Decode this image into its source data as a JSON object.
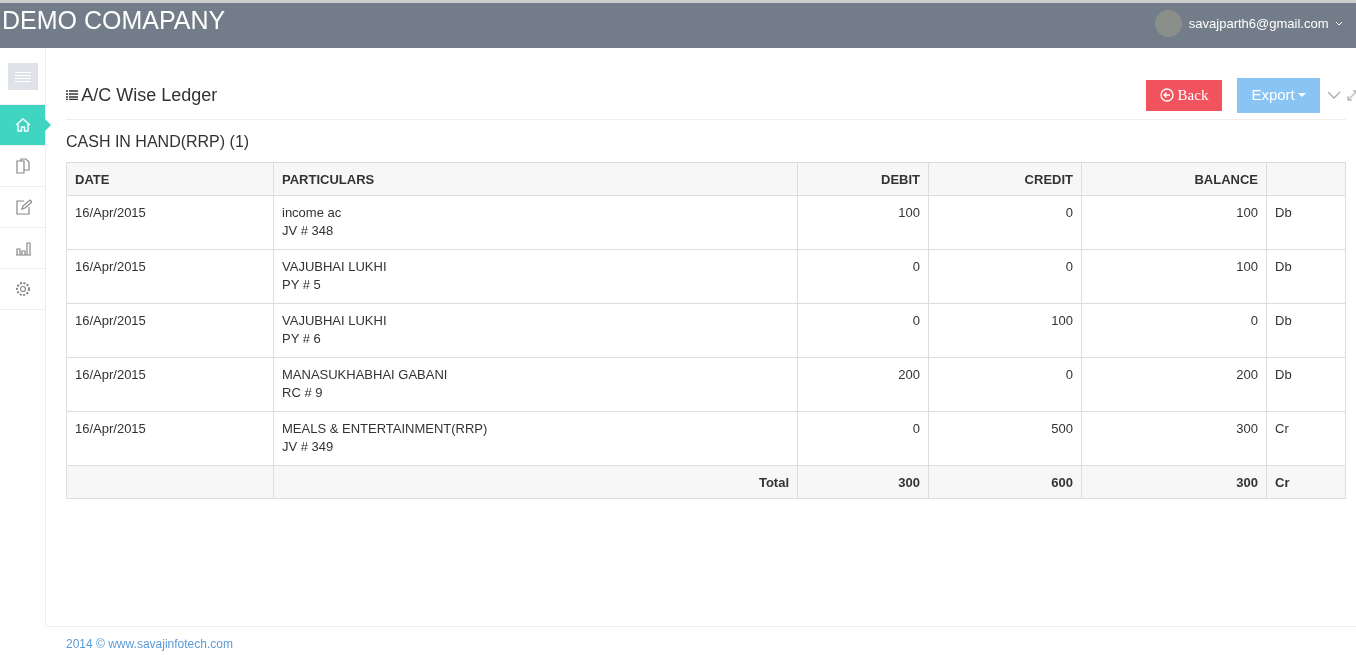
{
  "header": {
    "brand": "DEMO COMAPANY",
    "user_email": "savajparth6@gmail.com"
  },
  "sidebar": {
    "items": [
      {
        "kind": "home",
        "selected": true
      },
      {
        "kind": "documents",
        "selected": false
      },
      {
        "kind": "edit",
        "selected": false
      },
      {
        "kind": "chart",
        "selected": false
      },
      {
        "kind": "settings",
        "selected": false
      }
    ]
  },
  "panel": {
    "title": "A/C Wise Ledger",
    "buttons": [
      {
        "kind": "back",
        "label": "Back"
      },
      {
        "kind": "export",
        "label": "Export"
      }
    ]
  },
  "ledger": {
    "account": "CASH IN HAND(RRP) (1)",
    "columns": [
      "DATE",
      "PARTICULARS",
      "DEBIT",
      "CREDIT",
      "BALANCE"
    ],
    "rows": [
      {
        "date": "16/Apr/2015",
        "particulars": "income ac",
        "voucher": "JV # 348",
        "debit": "100",
        "credit": "0",
        "balance": "100",
        "type": "Db"
      },
      {
        "date": "16/Apr/2015",
        "particulars": "VAJUBHAI LUKHI",
        "voucher": "PY # 5",
        "debit": "0",
        "credit": "0",
        "balance": "100",
        "type": "Db"
      },
      {
        "date": "16/Apr/2015",
        "particulars": "VAJUBHAI LUKHI",
        "voucher": "PY # 6",
        "debit": "0",
        "credit": "100",
        "balance": "0",
        "type": "Db"
      },
      {
        "date": "16/Apr/2015",
        "particulars": "MANASUKHABHAI GABANI",
        "voucher": "RC # 9",
        "debit": "200",
        "credit": "0",
        "balance": "200",
        "type": "Db"
      },
      {
        "date": "16/Apr/2015",
        "particulars": "MEALS & ENTERTAINMENT(RRP)",
        "voucher": "JV # 349",
        "debit": "0",
        "credit": "500",
        "balance": "300",
        "type": "Cr"
      }
    ],
    "total": {
      "label": "Total",
      "debit": "300",
      "credit": "600",
      "balance": "300",
      "type": "Cr"
    }
  },
  "footer": "2014 © www.savajinfotech.com"
}
